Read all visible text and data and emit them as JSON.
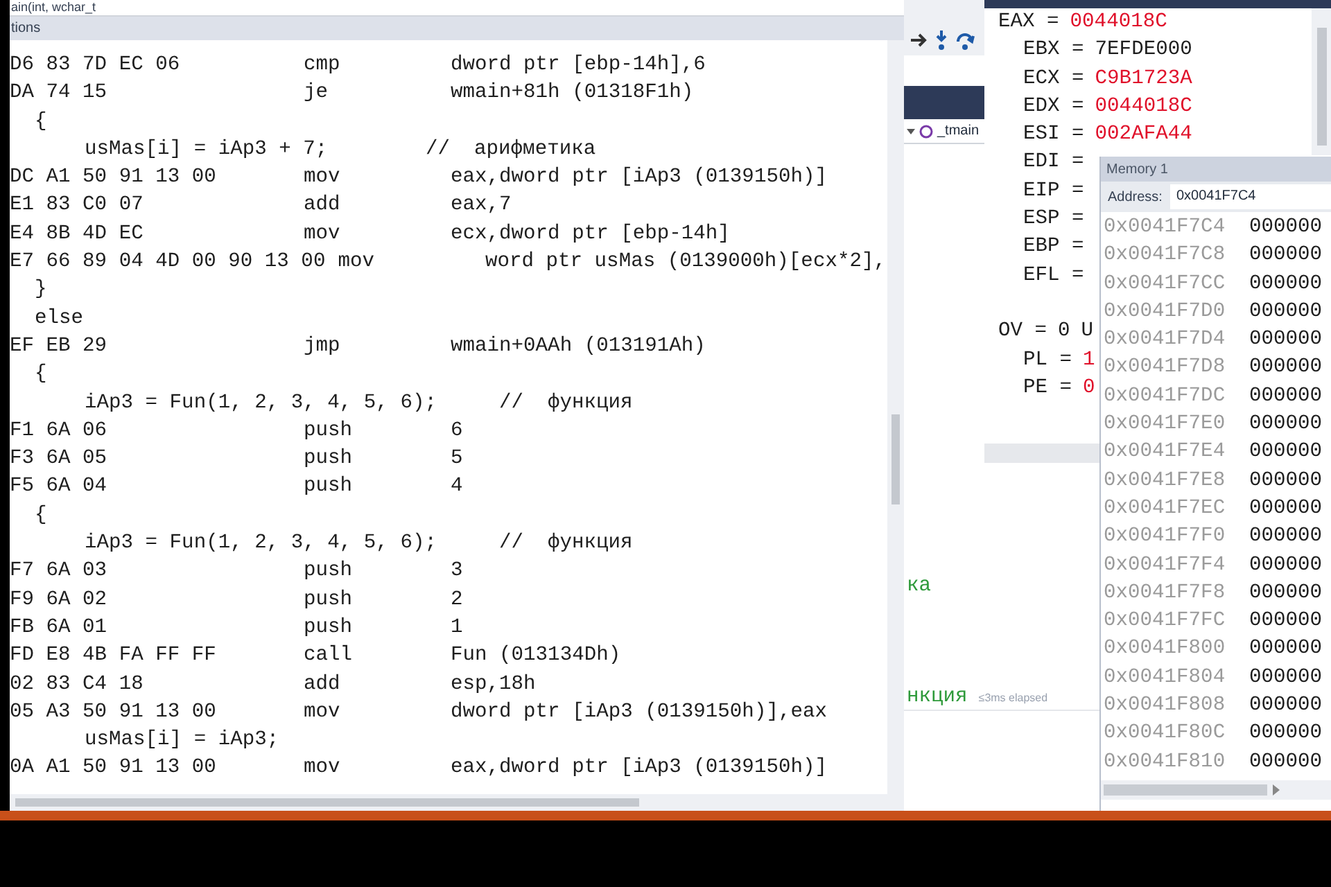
{
  "disassembly": {
    "function_header": "ain(int, wchar_t",
    "options_bar": "tions",
    "lines": [
      {
        "kind": "instr",
        "bytes": "D6 83 7D EC 06",
        "mnemonic": "cmp",
        "operand": "dword ptr [ebp-14h],6"
      },
      {
        "kind": "instr",
        "bytes": "DA 74 15",
        "mnemonic": "je",
        "operand": "wmain+81h (01318F1h)"
      },
      {
        "kind": "brace",
        "text": "{"
      },
      {
        "kind": "source",
        "code": "usMas[i] = iAp3 + 7;",
        "comment": "//  арифметика"
      },
      {
        "kind": "instr",
        "bytes": "DC A1 50 91 13 00",
        "mnemonic": "mov",
        "operand": "eax,dword ptr [iAp3 (0139150h)]"
      },
      {
        "kind": "instr",
        "bytes": "E1 83 C0 07",
        "mnemonic": "add",
        "operand": "eax,7"
      },
      {
        "kind": "instr",
        "bytes": "E4 8B 4D EC",
        "mnemonic": "mov",
        "operand": "ecx,dword ptr [ebp-14h]"
      },
      {
        "kind": "long",
        "bytes": "E7 66 89 04 4D 00 90 13 00",
        "mnemonic": "mov",
        "operand": "word ptr usMas (0139000h)[ecx*2],"
      },
      {
        "kind": "brace",
        "text": "}"
      },
      {
        "kind": "brace",
        "text": "else"
      },
      {
        "kind": "instr",
        "bytes": "EF EB 29",
        "mnemonic": "jmp",
        "operand": "wmain+0AAh (013191Ah)"
      },
      {
        "kind": "brace",
        "text": "{"
      },
      {
        "kind": "source",
        "code": "iAp3 = Fun(1, 2, 3, 4, 5, 6);",
        "comment": "//  функция"
      },
      {
        "kind": "instr",
        "bytes": "F1 6A 06",
        "mnemonic": "push",
        "operand": "6"
      },
      {
        "kind": "instr",
        "bytes": "F3 6A 05",
        "mnemonic": "push",
        "operand": "5"
      },
      {
        "kind": "instr",
        "bytes": "F5 6A 04",
        "mnemonic": "push",
        "operand": "4"
      },
      {
        "kind": "brace",
        "text": "{"
      },
      {
        "kind": "source",
        "code": "iAp3 = Fun(1, 2, 3, 4, 5, 6);",
        "comment": "//  функция"
      },
      {
        "kind": "instr",
        "bytes": "F7 6A 03",
        "mnemonic": "push",
        "operand": "3"
      },
      {
        "kind": "instr",
        "bytes": "F9 6A 02",
        "mnemonic": "push",
        "operand": "2"
      },
      {
        "kind": "instr",
        "bytes": "FB 6A 01",
        "mnemonic": "push",
        "operand": "1"
      },
      {
        "kind": "instr",
        "bytes": "FD E8 4B FA FF FF",
        "mnemonic": "call",
        "operand": "Fun (013134Dh)"
      },
      {
        "kind": "instr",
        "bytes": "02 83 C4 18",
        "mnemonic": "add",
        "operand": "esp,18h"
      },
      {
        "kind": "instr",
        "bytes": "05 A3 50 91 13 00",
        "mnemonic": "mov",
        "operand": "dword ptr [iAp3 (0139150h)],eax"
      },
      {
        "kind": "source",
        "code": "usMas[i] = iAp3;"
      },
      {
        "kind": "instr",
        "bytes": "0A A1 50 91 13 00",
        "mnemonic": "mov",
        "operand": "eax,dword ptr [iAp3 (0139150h)]"
      }
    ]
  },
  "editor": {
    "tab": "_tmain",
    "comment_fragment_1": "ка",
    "comment_fragment_2": "нкция",
    "elapsed": "≤3ms elapsed"
  },
  "registers": {
    "rows": [
      {
        "name": "EAX =",
        "value": "0044018C",
        "changed": true
      },
      {
        "name": "EBX =",
        "value": "7EFDE000",
        "changed": false
      },
      {
        "name": "ECX =",
        "value": "C9B1723A",
        "changed": true
      },
      {
        "name": "EDX =",
        "value": "0044018C",
        "changed": true
      },
      {
        "name": "ESI =",
        "value": "002AFA44",
        "changed": true
      },
      {
        "name": "EDI ="
      },
      {
        "name": "EIP ="
      },
      {
        "name": "ESP ="
      },
      {
        "name": "EBP ="
      },
      {
        "name": "EFL ="
      }
    ],
    "flags": [
      {
        "name": "OV =",
        "value": "0",
        "changed": false,
        "next": "U"
      },
      {
        "name": "PL =",
        "value": "1",
        "changed": true
      },
      {
        "name": "PE =",
        "value": "0",
        "changed": true
      }
    ]
  },
  "memory": {
    "title": "Memory 1",
    "address_label": "Address:",
    "address": "0x0041F7C4",
    "rows": [
      {
        "address": "0x0041F7C4",
        "value": "000000"
      },
      {
        "address": "0x0041F7C8",
        "value": "000000"
      },
      {
        "address": "0x0041F7CC",
        "value": "000000"
      },
      {
        "address": "0x0041F7D0",
        "value": "000000"
      },
      {
        "address": "0x0041F7D4",
        "value": "000000"
      },
      {
        "address": "0x0041F7D8",
        "value": "000000"
      },
      {
        "address": "0x0041F7DC",
        "value": "000000"
      },
      {
        "address": "0x0041F7E0",
        "value": "000000"
      },
      {
        "address": "0x0041F7E4",
        "value": "000000"
      },
      {
        "address": "0x0041F7E8",
        "value": "000000"
      },
      {
        "address": "0x0041F7EC",
        "value": "000000"
      },
      {
        "address": "0x0041F7F0",
        "value": "000000"
      },
      {
        "address": "0x0041F7F4",
        "value": "000000"
      },
      {
        "address": "0x0041F7F8",
        "value": "000000"
      },
      {
        "address": "0x0041F7FC",
        "value": "000000"
      },
      {
        "address": "0x0041F800",
        "value": "000000"
      },
      {
        "address": "0x0041F804",
        "value": "000000"
      },
      {
        "address": "0x0041F808",
        "value": "000000"
      },
      {
        "address": "0x0041F80C",
        "value": "000000"
      },
      {
        "address": "0x0041F810",
        "value": "000000"
      }
    ]
  }
}
